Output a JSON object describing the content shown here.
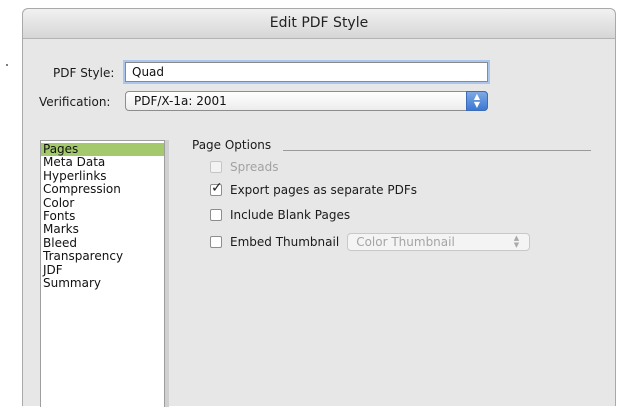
{
  "dialog": {
    "title": "Edit PDF Style"
  },
  "pdf_style": {
    "label": "PDF Style:",
    "value": "Quad"
  },
  "verification": {
    "label": "Verification:",
    "value": "PDF/X-1a: 2001"
  },
  "sidebar": {
    "items": [
      "Pages",
      "Meta Data",
      "Hyperlinks",
      "Compression",
      "Color",
      "Fonts",
      "Marks",
      "Bleed",
      "Transparency",
      "JDF",
      "Summary"
    ],
    "selected_index": 0
  },
  "page_options": {
    "title": "Page Options",
    "spreads": {
      "label": "Spreads",
      "checked": false,
      "enabled": false
    },
    "export_separate": {
      "label": "Export pages as separate PDFs",
      "checked": true,
      "enabled": true
    },
    "include_blank": {
      "label": "Include Blank Pages",
      "checked": false,
      "enabled": true
    },
    "embed_thumbnail": {
      "label": "Embed Thumbnail",
      "checked": false,
      "enabled": true,
      "select_value": "Color Thumbnail",
      "select_enabled": false
    }
  },
  "colors": {
    "selection": "#a3c96c",
    "accent": "#3b78d4"
  }
}
